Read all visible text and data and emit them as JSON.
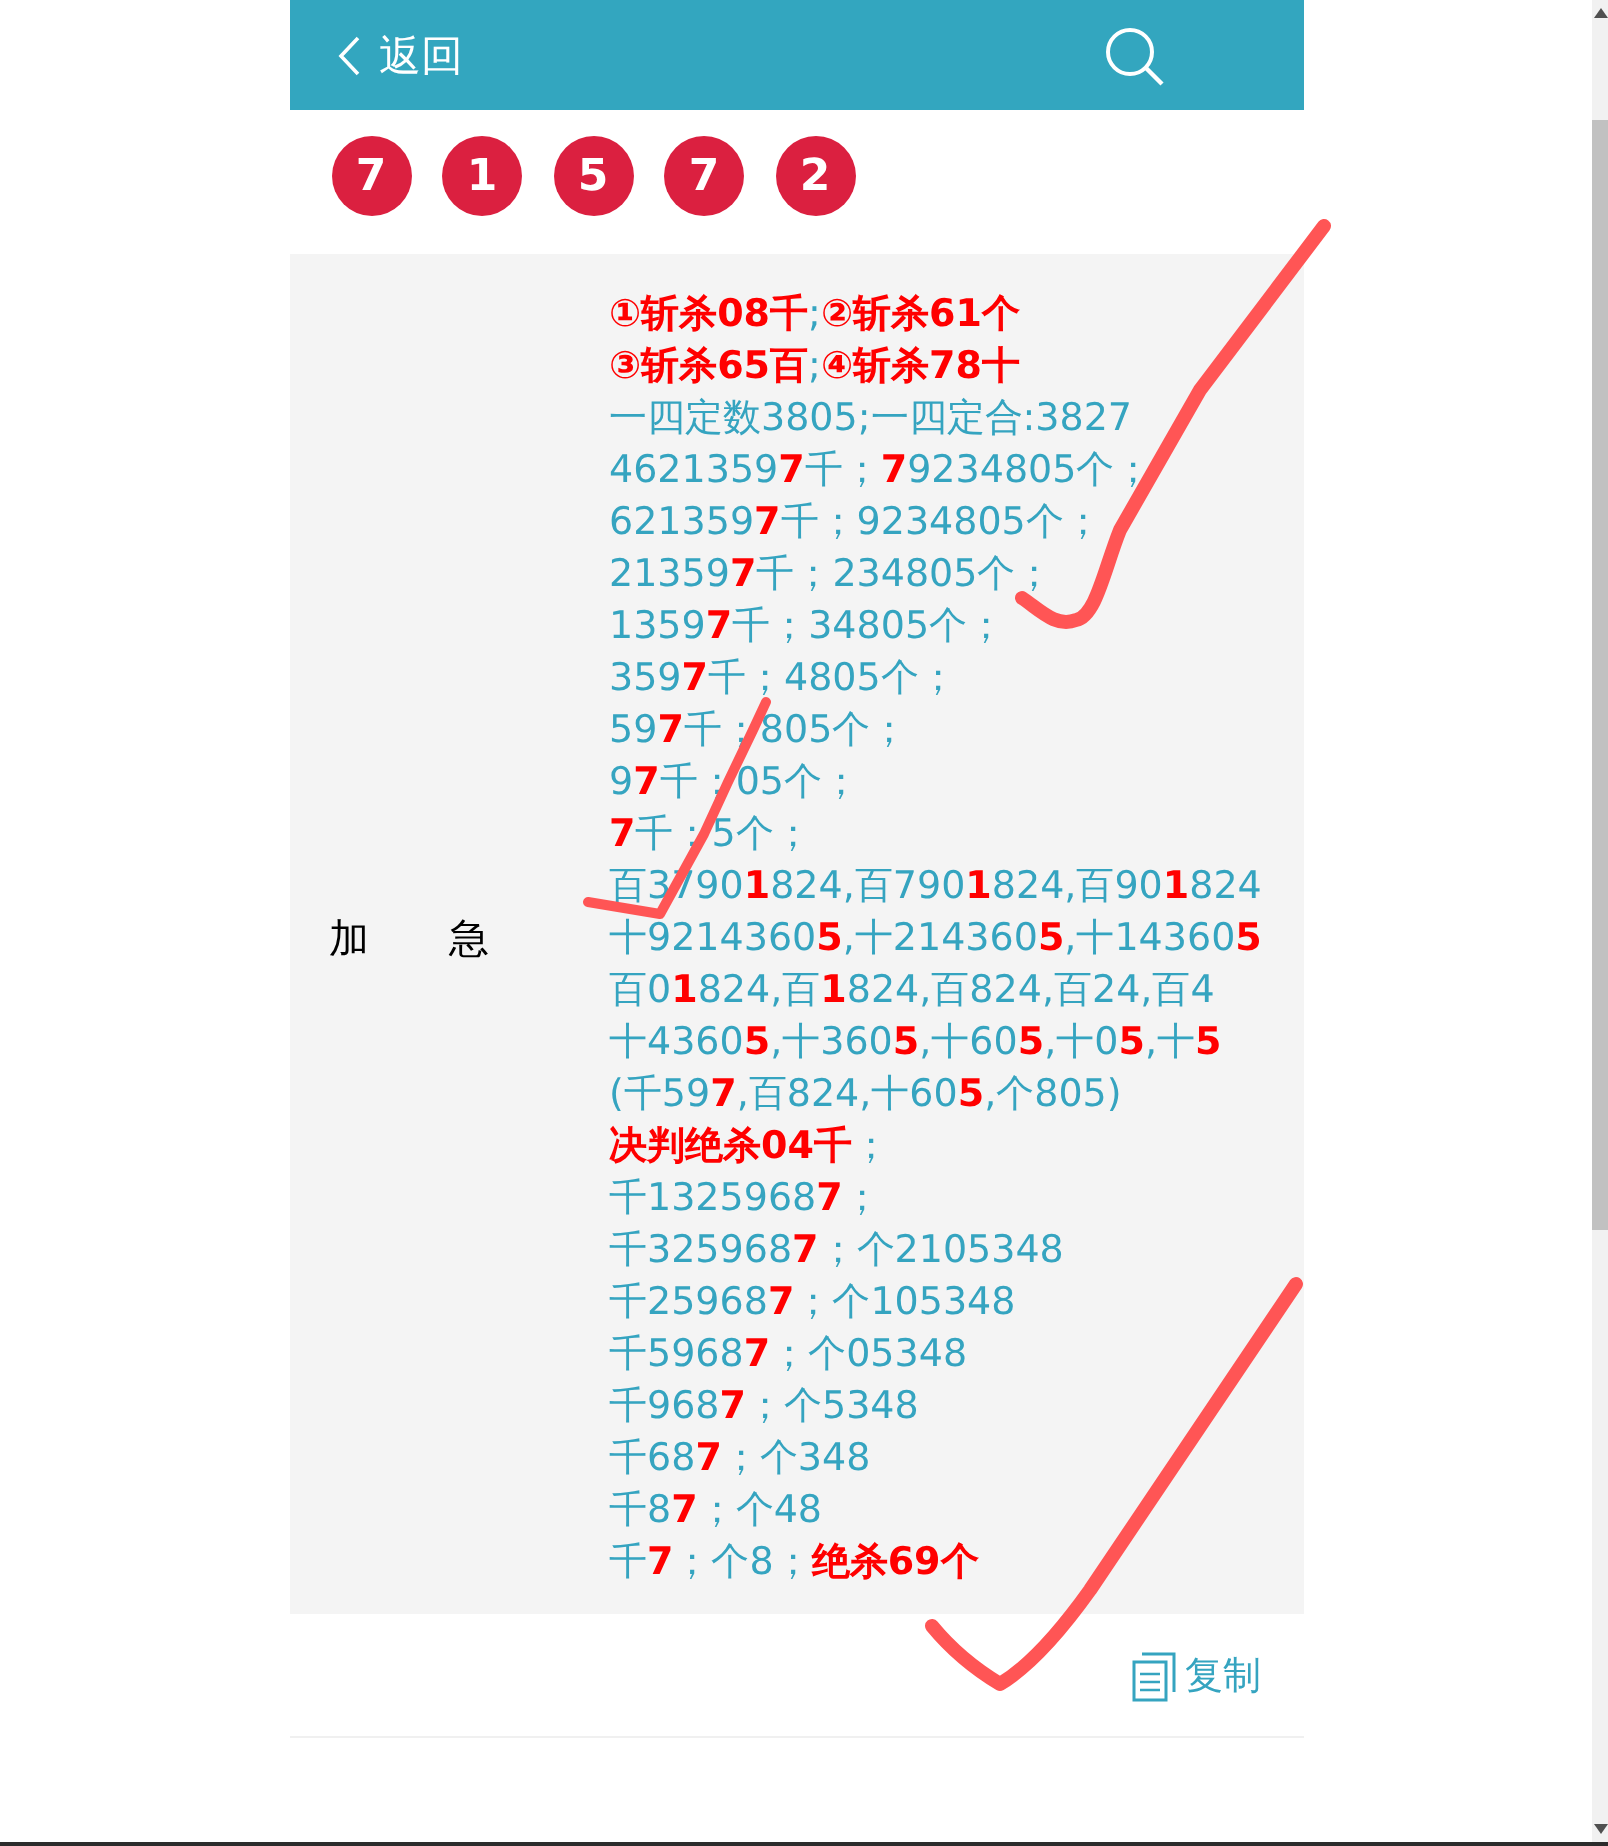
{
  "header": {
    "back_label": "返回"
  },
  "numbers": [
    "7",
    "1",
    "5",
    "7",
    "2"
  ],
  "entry": {
    "label": "加　　急",
    "lines": [
      "**①斩杀08千**;**②斩杀61个**",
      "**③斩杀65百**;**④斩杀78十**",
      "一四定数3805;一四定合:3827",
      "4621359**7**千；**7**9234805个；",
      "621359**7**千；9234805个；",
      "21359**7**千；234805个；",
      "1359**7**千；34805个；",
      "359**7**千；4805个；",
      "59**7**千；805个；",
      "9**7**千；05个；",
      "**7**千；5个；",
      "百3790**1**824,百790**1**824,百90**1**824",
      "十9214360**5**,十214360**5**,十14360**5**",
      "百0**1**824,百**1**824,百824,百24,百4",
      "十4360**5**,十360**5**,十60**5**,十0**5**,十**5**",
      "(千59**7**,百824,十60**5**,个805)",
      "**决判绝杀04千**；",
      "千1325968**7**；",
      "千325968**7**；个2105348",
      "千25968**7**；个105348",
      "千5968**7**；个05348",
      "千968**7**；个5348",
      "千68**7**；个348",
      "千8**7**；个48",
      "千**7**；个8；**绝杀69个**"
    ]
  },
  "copy_button": {
    "label": "复制"
  }
}
